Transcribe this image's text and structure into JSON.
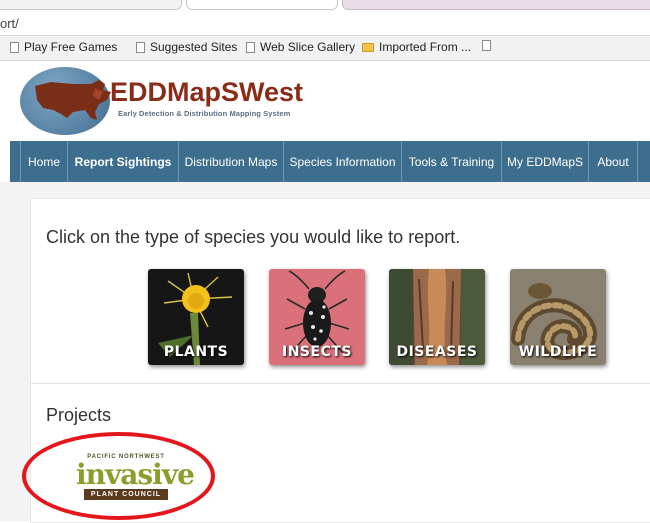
{
  "browser": {
    "url_fragment": "ort/",
    "bookmarks": [
      {
        "label": "Play Free Games",
        "icon": "page-icon"
      },
      {
        "label": "Suggested Sites",
        "icon": "page-icon"
      },
      {
        "label": "Web Slice Gallery",
        "icon": "page-icon"
      },
      {
        "label": "Imported From ...",
        "icon": "folder-icon"
      },
      {
        "label": "",
        "icon": "page-icon"
      }
    ]
  },
  "header": {
    "logo_title": "EDDMapSWest",
    "logo_subtitle": "Early Detection & Distribution Mapping System"
  },
  "nav": {
    "items": [
      {
        "label": "Home"
      },
      {
        "label": "Report Sightings"
      },
      {
        "label": "Distribution Maps"
      },
      {
        "label": "Species Information"
      },
      {
        "label": "Tools & Training"
      },
      {
        "label": "My EDDMapS"
      },
      {
        "label": "About"
      }
    ]
  },
  "main": {
    "prompt": "Click on the type of species you would like to report.",
    "species": [
      {
        "label": "Plants"
      },
      {
        "label": "Insects"
      },
      {
        "label": "Diseases"
      },
      {
        "label": "Wildlife"
      }
    ],
    "projects_heading": "Projects",
    "project_logo": {
      "top_text": "PACIFIC NORTHWEST",
      "main_text": "invasive",
      "band_text": "PLANT COUNCIL"
    }
  },
  "colors": {
    "nav_bg": "#3e6e8e",
    "logo_red": "#8a2c1a",
    "annotation_red": "#e3161c"
  }
}
